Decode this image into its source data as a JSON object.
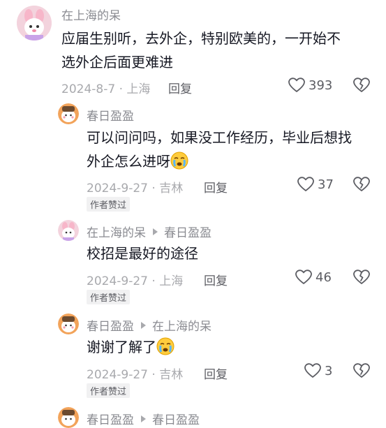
{
  "comments": [
    {
      "user": "在上海的呆",
      "text_lines": [
        "应届生别听，去外企，特别欧美的，一开始不",
        "选外企后面更难进"
      ],
      "date_location": "2024-8-7 · 上海",
      "reply_label": "回复",
      "likes": "393"
    },
    {
      "user": "春日盈盈",
      "text_lines": [
        "可以问问吗，如果没工作经历，毕业后想找",
        "外企怎么进呀"
      ],
      "date_location": "2024-9-27 · 吉林",
      "reply_label": "回复",
      "likes": "37",
      "badge": "作者赞过"
    },
    {
      "user": "在上海的呆",
      "reply_to": "春日盈盈",
      "text_lines": [
        "校招是最好的途径"
      ],
      "date_location": "2024-9-27 · 上海",
      "reply_label": "回复",
      "likes": "46",
      "badge": "作者赞过"
    },
    {
      "user": "春日盈盈",
      "reply_to": "在上海的呆",
      "text_lines": [
        "谢谢了解了"
      ],
      "date_location": "2024-9-27 · 吉林",
      "reply_label": "回复",
      "likes": "3",
      "badge": "作者赞过"
    },
    {
      "user": "春日盈盈",
      "reply_to": "春日盈盈"
    }
  ],
  "icons": {
    "like": "heart-outline-icon",
    "dislike": "broken-heart-icon",
    "emoji": "crying-face-emoji",
    "arrow": "reply-arrow-icon"
  },
  "colors": {
    "username": "#8a8b91",
    "meta": "#a8a9ad",
    "text": "#161823",
    "badge_bg": "#f1f1f2"
  }
}
